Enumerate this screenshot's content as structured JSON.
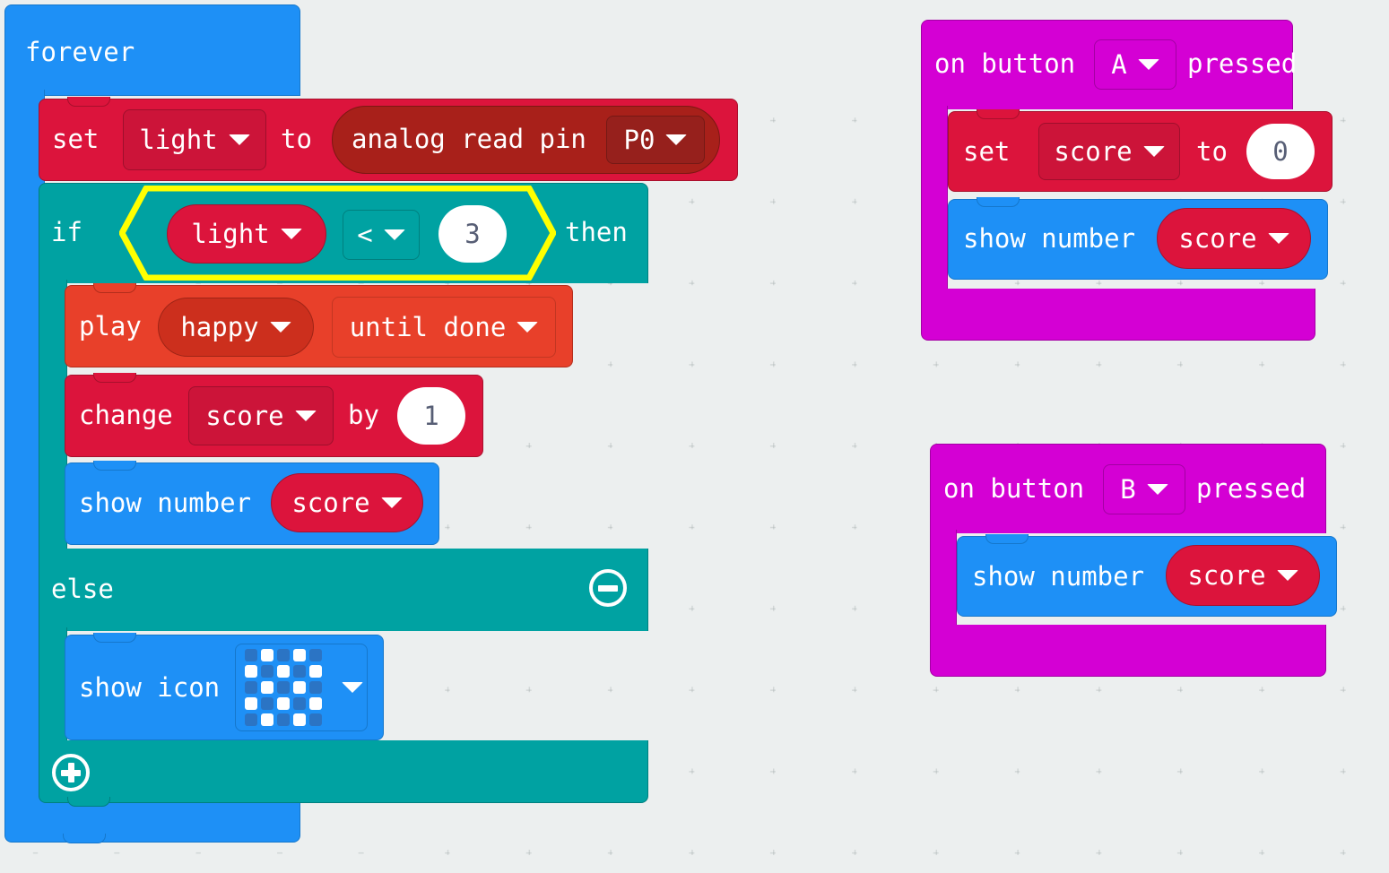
{
  "canvas": {
    "background_color": "#ecefef",
    "grid_marker": "plus-cross",
    "grid_color": "#d7dcdc"
  },
  "palette": {
    "loops_blue": "#1e90f6",
    "basic_blue": "#1e90f6",
    "logic_teal": "#00a2a2",
    "variables_crimson": "#dc143c",
    "pins_dark_red": "#a8201a",
    "music_orange_red": "#e8402a",
    "events_magenta": "#d400d4",
    "selection_yellow": "#ffff00",
    "field_white": "#ffffff",
    "field_text_dark": "#575e75"
  },
  "scripts": {
    "forever": {
      "header_label": "forever",
      "children": {
        "set_light": {
          "label_set": "set",
          "variable": "light",
          "label_to": "to",
          "reporter": {
            "label": "analog read pin",
            "pin": "P0"
          }
        },
        "if_else": {
          "label_if": "if",
          "label_then": "then",
          "label_else": "else",
          "selected": true,
          "condition": {
            "left_variable": "light",
            "operator": "<",
            "right_value": "3"
          },
          "collapse_button": "minus-circle",
          "expand_button": "plus-circle",
          "then_body": {
            "play": {
              "label_play": "play",
              "melody": "happy",
              "mode": "until done"
            },
            "change_score": {
              "label_change": "change",
              "variable": "score",
              "label_by": "by",
              "amount": "1"
            },
            "show_number": {
              "label": "show number",
              "variable": "score"
            }
          },
          "else_body": {
            "show_icon": {
              "label": "show icon",
              "icon_name": "chessboard",
              "led_matrix": [
                [
                  0,
                  1,
                  0,
                  1,
                  0
                ],
                [
                  1,
                  0,
                  1,
                  0,
                  1
                ],
                [
                  0,
                  1,
                  0,
                  1,
                  0
                ],
                [
                  1,
                  0,
                  1,
                  0,
                  1
                ],
                [
                  0,
                  1,
                  0,
                  1,
                  0
                ]
              ]
            }
          }
        }
      }
    },
    "on_button_a": {
      "label_on_button": "on button",
      "button": "A",
      "label_pressed": "pressed",
      "children": {
        "set_score": {
          "label_set": "set",
          "variable": "score",
          "label_to": "to",
          "value": "0"
        },
        "show_number": {
          "label": "show number",
          "variable": "score"
        }
      }
    },
    "on_button_b": {
      "label_on_button": "on button",
      "button": "B",
      "label_pressed": "pressed",
      "children": {
        "show_number": {
          "label": "show number",
          "variable": "score"
        }
      }
    }
  }
}
